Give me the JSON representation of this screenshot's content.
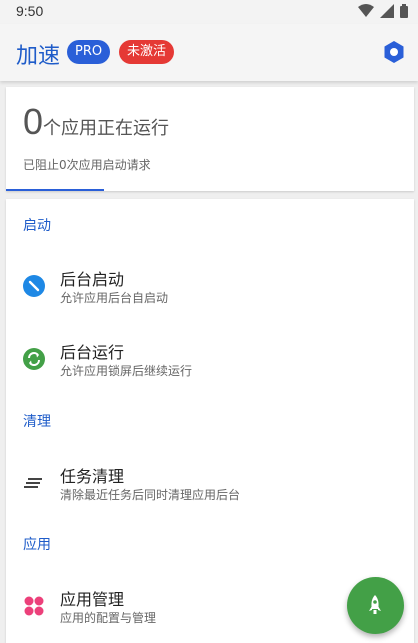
{
  "status_bar": {
    "time": "9:50",
    "icons": [
      "wifi-icon",
      "signal-icon",
      "battery-icon"
    ]
  },
  "app_bar": {
    "title": "加速",
    "pro_badge": "PRO",
    "inactive_badge": "未激活",
    "action_icon": "hexagon-icon"
  },
  "summary": {
    "running_count": "0",
    "running_text": "个应用正在运行",
    "blocked_text": "已阻止0次应用启动请求"
  },
  "sections": {
    "startup": {
      "header": "启动",
      "items": [
        {
          "title": "后台启动",
          "subtitle": "允许应用后台自启动",
          "icon": "block-icon"
        },
        {
          "title": "后台运行",
          "subtitle": "允许应用锁屏后继续运行",
          "icon": "sync-icon"
        }
      ]
    },
    "cleanup": {
      "header": "清理",
      "items": [
        {
          "title": "任务清理",
          "subtitle": "清除最近任务后同时清理应用后台",
          "icon": "clear-all-icon"
        }
      ]
    },
    "apps": {
      "header": "应用",
      "items": [
        {
          "title": "应用管理",
          "subtitle": "应用的配置与管理",
          "icon": "apps-grid-icon"
        }
      ]
    }
  },
  "fab": {
    "icon": "rocket-icon"
  },
  "colors": {
    "accent": "#1f5cc9",
    "pro": "#2a5fd8",
    "inactive": "#e53935",
    "fab": "#43a047"
  }
}
